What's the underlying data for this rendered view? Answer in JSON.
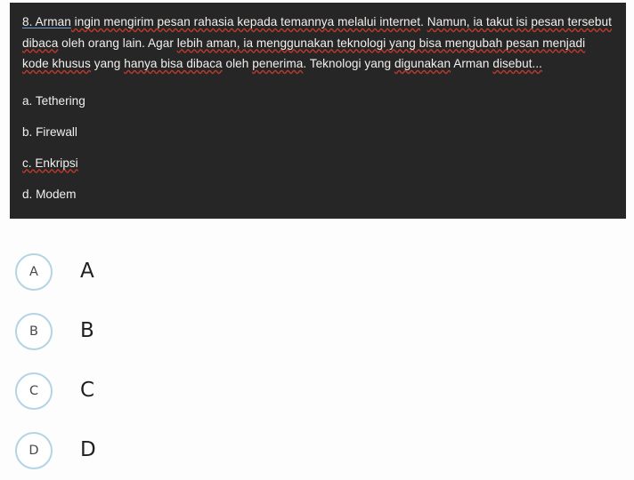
{
  "question_card": {
    "background_color": "#262626",
    "text_color": "#f2f0ee",
    "number": "8.",
    "stem_segments": [
      {
        "text": "8.",
        "mark": "grammar"
      },
      {
        "text": " Arman",
        "mark": "grammar"
      },
      {
        "text": " ingin mengirim pesan rahasia kepada temannya melalui internet",
        "mark": "spelling"
      },
      {
        "text": ". ",
        "mark": "none"
      },
      {
        "text": "Namun, ia takut isi pesan tersebut dibaca",
        "mark": "spelling"
      },
      {
        "text": " oleh orang lain. Agar ",
        "mark": "none"
      },
      {
        "text": "lebih aman, ia menggunakan teknologi yang bisa mengubah pesan menjadi kode khusus",
        "mark": "spelling"
      },
      {
        "text": " yang ",
        "mark": "none"
      },
      {
        "text": "hanya bisa dibaca",
        "mark": "spelling"
      },
      {
        "text": " oleh ",
        "mark": "none"
      },
      {
        "text": "penerima",
        "mark": "spelling"
      },
      {
        "text": ". Teknologi yang ",
        "mark": "none"
      },
      {
        "text": "digunakan",
        "mark": "spelling"
      },
      {
        "text": " Arman ",
        "mark": "none"
      },
      {
        "text": "disebut...",
        "mark": "spelling"
      }
    ],
    "stem_full_text": "8. Arman ingin mengirim pesan rahasia kepada temannya melalui internet. Namun, ia takut isi pesan tersebut dibaca oleh orang lain. Agar lebih aman, ia menggunakan teknologi yang bisa mengubah pesan menjadi kode khusus yang hanya bisa dibaca oleh penerima. Teknologi yang digunakan Arman disebut...",
    "options": [
      {
        "label": "a. Tethering",
        "misspelled": false
      },
      {
        "label": "b. Firewall",
        "misspelled": false
      },
      {
        "label": "c. Enkripsi",
        "misspelled": true
      },
      {
        "label": "d. Modem",
        "misspelled": false
      }
    ],
    "spellcheck_underline_color": "#c0392b",
    "grammar_underline_color": "#6ba3d6"
  },
  "choices": {
    "bubble_border_color": "#b3d4e3",
    "items": [
      {
        "bubble": "A",
        "label": "A"
      },
      {
        "bubble": "B",
        "label": "B"
      },
      {
        "bubble": "C",
        "label": "C"
      },
      {
        "bubble": "D",
        "label": "D"
      }
    ]
  },
  "page": {
    "background_color": "#fdfdfd"
  }
}
